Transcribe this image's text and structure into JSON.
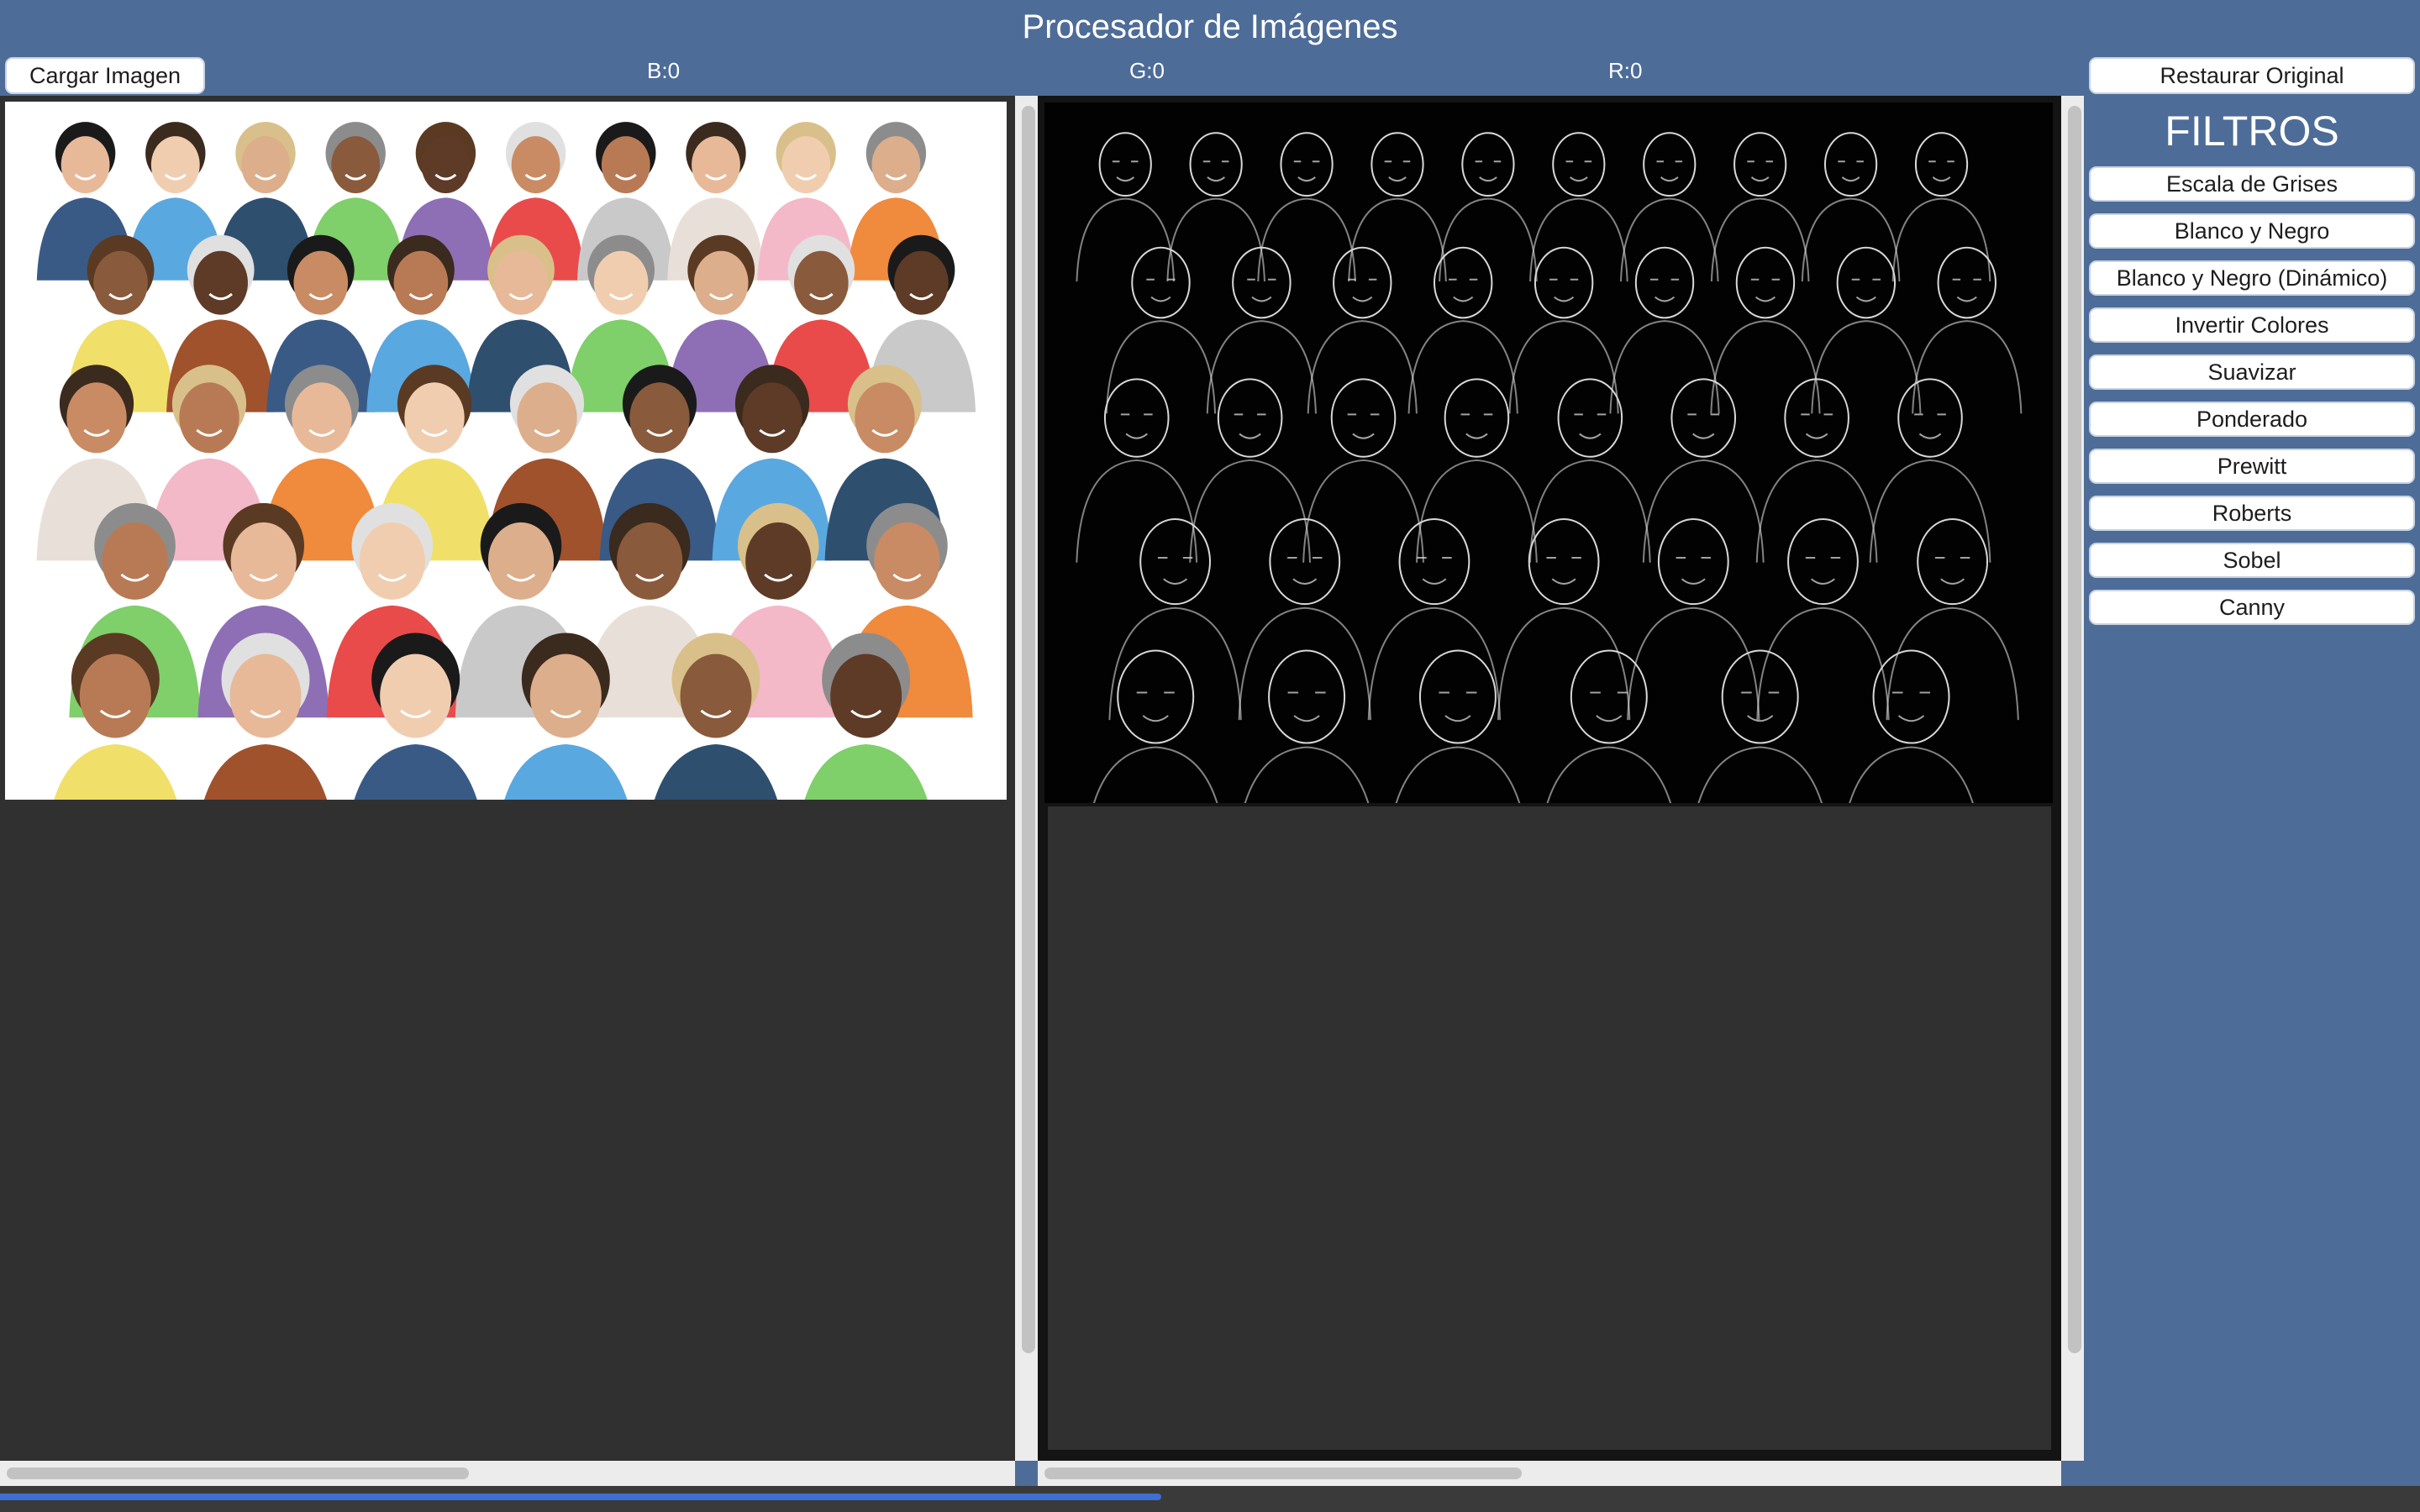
{
  "app": {
    "title": "Procesador de Imágenes"
  },
  "toolbar": {
    "load_label": "Cargar Imagen",
    "restore_label": "Restaurar Original",
    "channels": {
      "b": "B:0",
      "g": "G:0",
      "r": "R:0"
    }
  },
  "sidebar": {
    "title": "FILTROS",
    "filters": [
      "Escala de Grises",
      "Blanco y Negro",
      "Blanco y Negro (Dinámico)",
      "Invertir Colores",
      "Suavizar",
      "Ponderado",
      "Prewitt",
      "Roberts",
      "Sobel",
      "Canny"
    ]
  },
  "progress": {
    "fraction": 0.48
  },
  "colors": {
    "accent": "#4d6c98",
    "pane": "#303030",
    "progress": "#3f6fd0"
  }
}
